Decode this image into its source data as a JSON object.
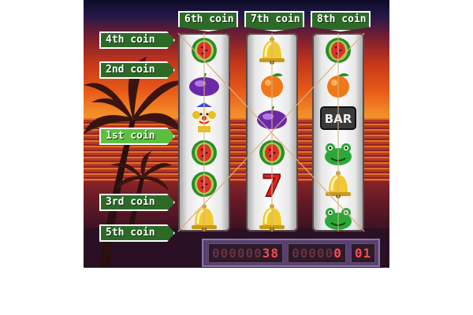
{
  "payline_labels": {
    "left": [
      "4th coin",
      "2nd coin",
      "1st coin",
      "3rd coin",
      "5th coin"
    ],
    "top": [
      "6th coin",
      "7th coin",
      "8th coin"
    ],
    "active": "1st coin"
  },
  "reels": [
    [
      "watermelon",
      "plum",
      "clown",
      "watermelon",
      "watermelon",
      "bell"
    ],
    [
      "bell",
      "orange",
      "plum",
      "watermelon",
      "seven",
      "bell"
    ],
    [
      "watermelon",
      "orange",
      "bar",
      "frog",
      "bell",
      "frog"
    ]
  ],
  "counters": {
    "credits": {
      "dim": "000000",
      "lit": "38"
    },
    "bet": {
      "dim": "00000",
      "lit": "0"
    },
    "payout": {
      "dim": "",
      "lit": "01"
    }
  },
  "symbols_text": {
    "bar": "BAR",
    "seven": "7"
  },
  "colors": {
    "label_bg": "#2d6a28",
    "label_active_bg": "#5cbf40",
    "counter_digit": "#ff4a4a"
  }
}
